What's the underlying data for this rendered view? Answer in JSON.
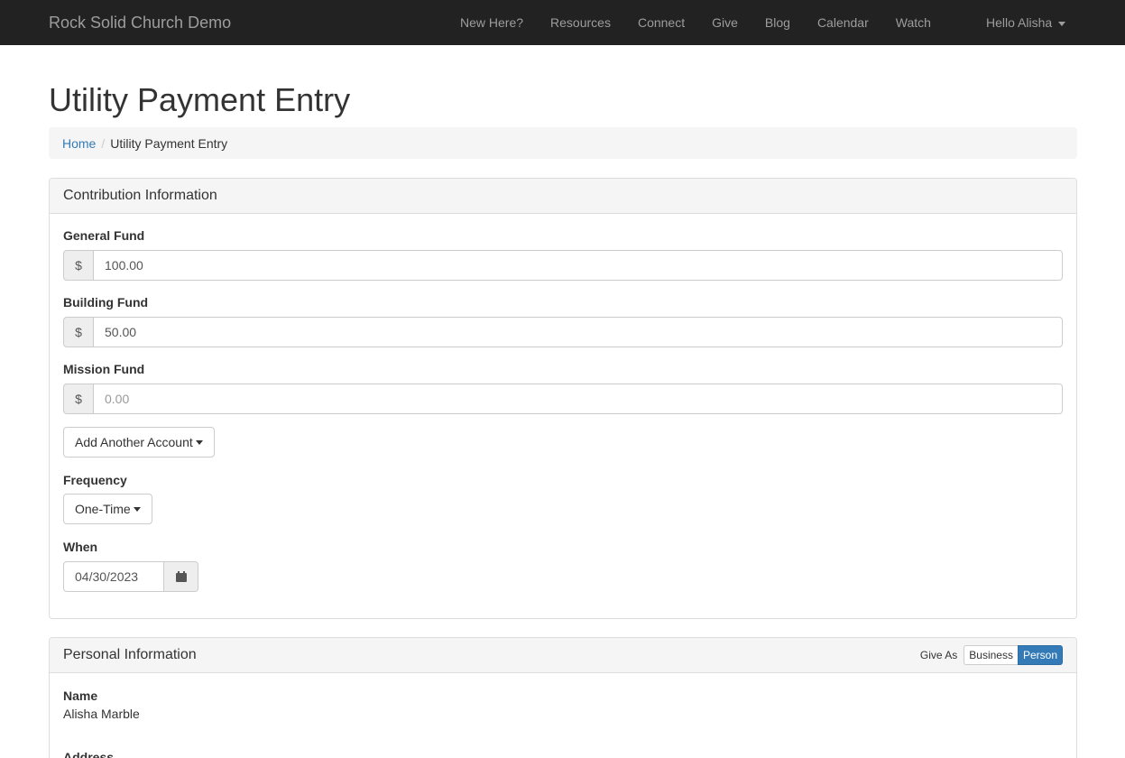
{
  "navbar": {
    "brand": "Rock Solid Church Demo",
    "links": [
      "New Here?",
      "Resources",
      "Connect",
      "Give",
      "Blog",
      "Calendar",
      "Watch"
    ],
    "user": "Hello Alisha"
  },
  "page": {
    "title": "Utility Payment Entry"
  },
  "breadcrumb": {
    "home": "Home",
    "separator": "/",
    "current": "Utility Payment Entry"
  },
  "contribution": {
    "heading": "Contribution Information",
    "currency_symbol": "$",
    "funds": [
      {
        "label": "General Fund",
        "value": "100.00"
      },
      {
        "label": "Building Fund",
        "value": "50.00"
      },
      {
        "label": "Mission Fund",
        "placeholder": "0.00"
      }
    ],
    "add_account_label": "Add Another Account",
    "frequency_label": "Frequency",
    "frequency_value": "One-Time",
    "when_label": "When",
    "when_value": "04/30/2023"
  },
  "personal": {
    "heading": "Personal Information",
    "give_as_label": "Give As",
    "give_as_options": [
      "Business",
      "Person"
    ],
    "give_as_selected": "Person",
    "name_label": "Name",
    "name_value": "Alisha Marble",
    "address_label": "Address"
  },
  "colors": {
    "navbar": "#222222",
    "accent": "#337ab7",
    "link": "#337ab7"
  }
}
